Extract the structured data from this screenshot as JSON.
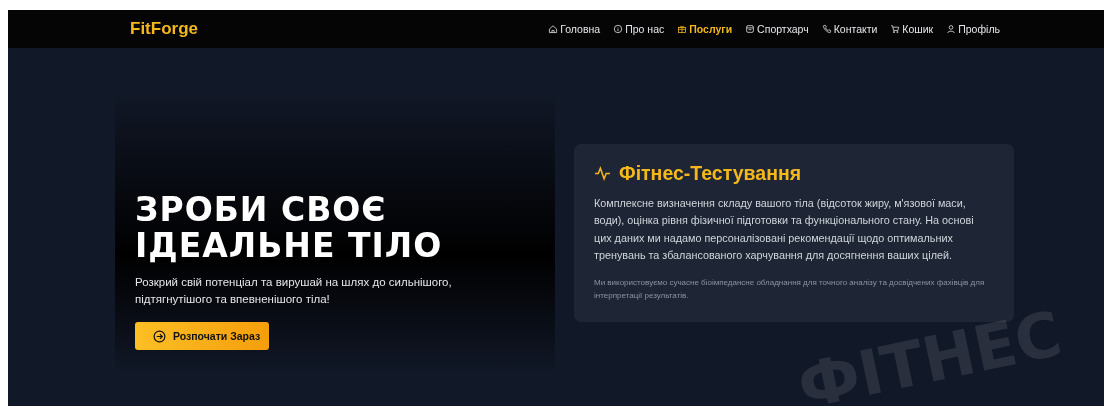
{
  "header": {
    "logo": "FitForge",
    "nav": [
      {
        "label": "Головна",
        "selected": false
      },
      {
        "label": "Про нас",
        "selected": false
      },
      {
        "label": "Послуги",
        "selected": true
      },
      {
        "label": "Спортхарч",
        "selected": false
      },
      {
        "label": "Контакти",
        "selected": false
      },
      {
        "label": "Кошик",
        "selected": false
      },
      {
        "label": "Профіль",
        "selected": false
      }
    ]
  },
  "hero": {
    "title_lines": [
      "ЗРОБИ СВОЄ",
      "ІДЕАЛЬНЕ ТІЛО"
    ],
    "subtitle": "Розкрий свій потенціал та вирушай на шлях до сильнішого, підтягнутішого та впевненішого тіла!",
    "button": "Розпочати Зараз"
  },
  "service_card": {
    "title": "Фітнес-Тестування",
    "description": "Комплексне визначення складу вашого тіла (відсоток жиру, м'язової маси, води), оцінка рівня фізичної підготовки та функціонального стану. На основі цих даних ми надамо персоналізовані рекомендації щодо оптимальних тренувань та збалансованого харчування для досягнення ваших цілей.",
    "note": "Ми використовуємо сучасне біоімпедансне обладнання для точного аналізу та досвідчених фахівців для інтерпретації результатів."
  },
  "decor_text": "ФІТНЕС"
}
